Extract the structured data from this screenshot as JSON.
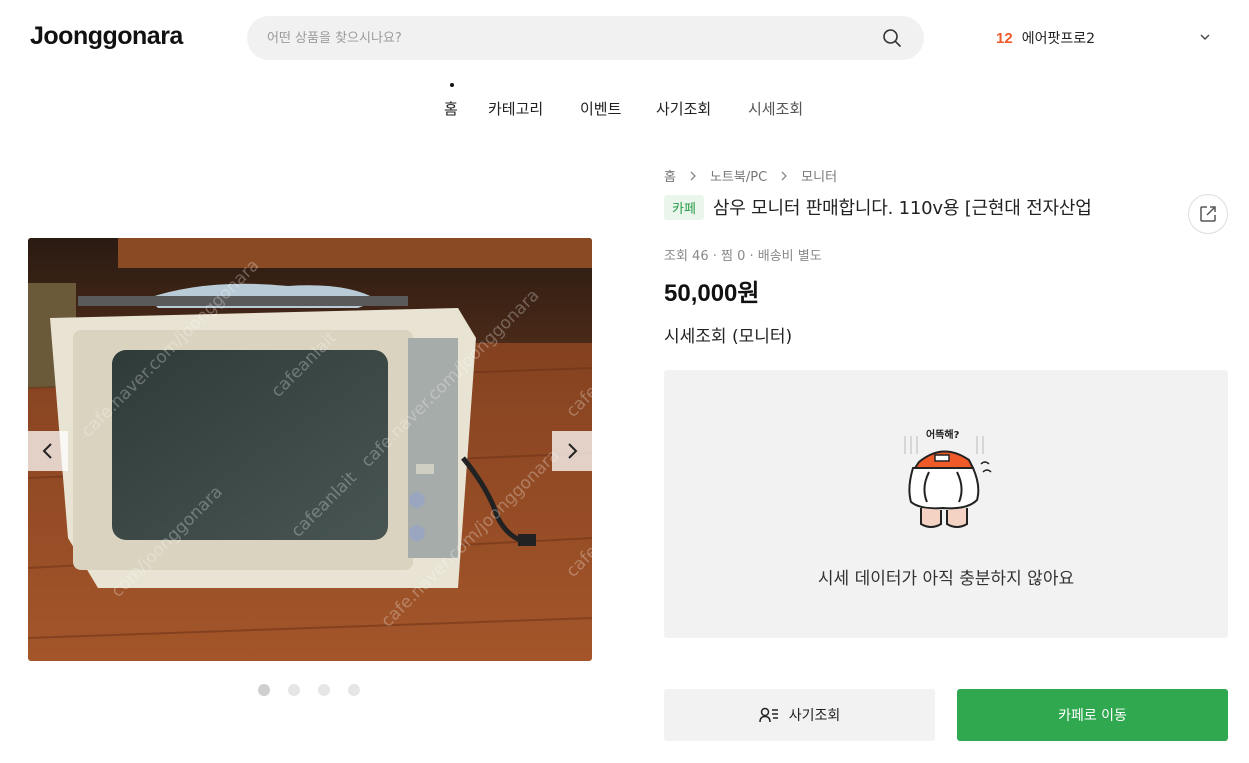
{
  "header": {
    "logo": "Joonggonara",
    "search_placeholder": "어떤 상품을 찾으시나요?",
    "notification_count": "12",
    "user_name": "에어팟프로2"
  },
  "nav": {
    "items": [
      {
        "label": "홈"
      },
      {
        "label": "카테고리"
      },
      {
        "label": "이벤트"
      },
      {
        "label": "사기조회"
      },
      {
        "label": "시세조회"
      }
    ]
  },
  "gallery": {
    "image_count": 4,
    "active_index": 0,
    "watermarks": [
      "cafe.naver.com/joonggonara",
      "cafeanlait"
    ]
  },
  "product": {
    "breadcrumb": [
      "홈",
      "노트북/PC",
      "모니터"
    ],
    "source_badge": "카페",
    "title": "삼우 모니터 판매합니다. 110v용 [근현대 전자산업",
    "meta": "조회 46 · 찜 0 · 배송비 별도",
    "price": "50,000원"
  },
  "market": {
    "title": "시세조회 (모니터)",
    "mascot_caption": "어뜩해?",
    "empty_message": "시세 데이터가 아직 충분하지 않아요"
  },
  "actions": {
    "fraud_check_label": "사기조회",
    "go_cafe_label": "카페로 이동"
  },
  "colors": {
    "accent_green": "#2fa84f",
    "count_orange": "#f25a2b",
    "badge_bg": "#eaf6ec"
  },
  "icons": [
    "search-icon",
    "chevron-down-icon",
    "chevron-left-icon",
    "chevron-right-icon",
    "share-icon",
    "user-list-icon",
    "chevron-right-small-icon"
  ]
}
